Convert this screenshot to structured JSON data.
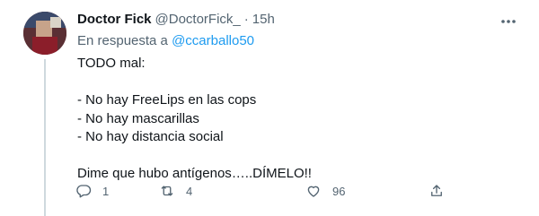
{
  "tweet": {
    "author_name": "Doctor Fick",
    "handle": "@DoctorFick_",
    "separator": "·",
    "time": "15h",
    "reply_prefix": "En respuesta a",
    "reply_mention": "@ccarballo50",
    "lines": [
      "TODO mal:",
      "",
      "- No hay FreeLips en las cops",
      "- No hay mascarillas",
      "- No hay distancia social",
      "",
      "Dime que hubo antígenos…..DÍMELO!!"
    ]
  },
  "actions": {
    "reply": {
      "icon": "reply-icon",
      "count": "1"
    },
    "retweet": {
      "icon": "retweet-icon",
      "count": "4"
    },
    "like": {
      "icon": "heart-icon",
      "count": "96"
    },
    "share": {
      "icon": "share-icon"
    }
  },
  "colors": {
    "link": "#1d9bf0",
    "secondary": "#536471",
    "text": "#0f1419",
    "thread_line": "#cfd9de"
  }
}
